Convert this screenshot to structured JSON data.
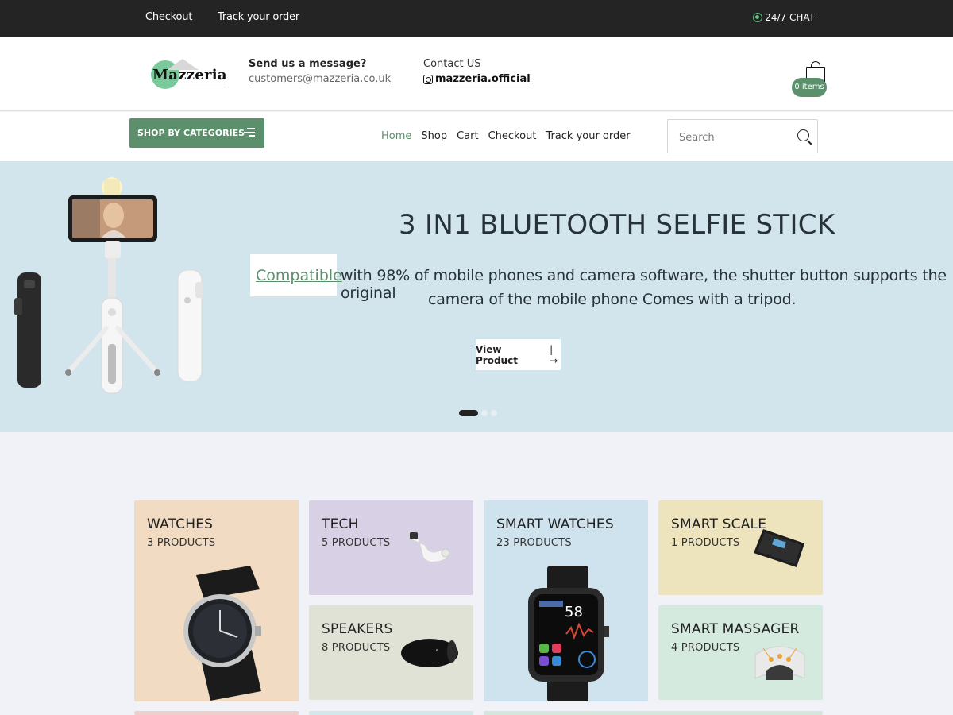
{
  "topbar": {
    "checkout": "Checkout",
    "track": "Track your order",
    "chat": "24/7 CHAT"
  },
  "header": {
    "logo_text": "Mazzeria",
    "message_heading": "Send us a message?",
    "email": "customers@mazzeria.co.uk",
    "contact_heading": "Contact US",
    "instagram": "mazzeria.official",
    "cart_items": "0 items"
  },
  "nav": {
    "categories_button": "SHOP BY CATEGORIES",
    "links": [
      "Home",
      "Shop",
      "Cart",
      "Checkout",
      "Track your order"
    ],
    "search_placeholder": "Search"
  },
  "hero": {
    "title": "3 IN1 BLUETOOTH SELFIE STICK",
    "highlight": "Compatible",
    "description_line1": "with 98% of mobile phones and camera software, the shutter button supports the original",
    "description_line2": "camera of the mobile phone Comes with a tripod.",
    "button": "View Product",
    "slide_count": 3,
    "active_slide": 1
  },
  "categories": [
    {
      "name": "WATCHES",
      "count": "3 PRODUCTS",
      "color": "#f1dbc2"
    },
    {
      "name": "TECH",
      "count": "5 PRODUCTS",
      "color": "#d8d1e5"
    },
    {
      "name": "SMART WATCHES",
      "count": "23 PRODUCTS",
      "color": "#cfe3ee"
    },
    {
      "name": "SMART SCALE",
      "count": "1 PRODUCTS",
      "color": "#ede3bd"
    },
    {
      "name": "SPEAKERS",
      "count": "8 PRODUCTS",
      "color": "#e1e2d6"
    },
    {
      "name": "SMART MASSAGER",
      "count": "4 PRODUCTS",
      "color": "#d5eadf"
    }
  ],
  "colors": {
    "accent": "#5c8f6c",
    "topbar": "#242424",
    "hero_bg": "#d3e5ec",
    "page_bg": "#f1f2f7"
  }
}
